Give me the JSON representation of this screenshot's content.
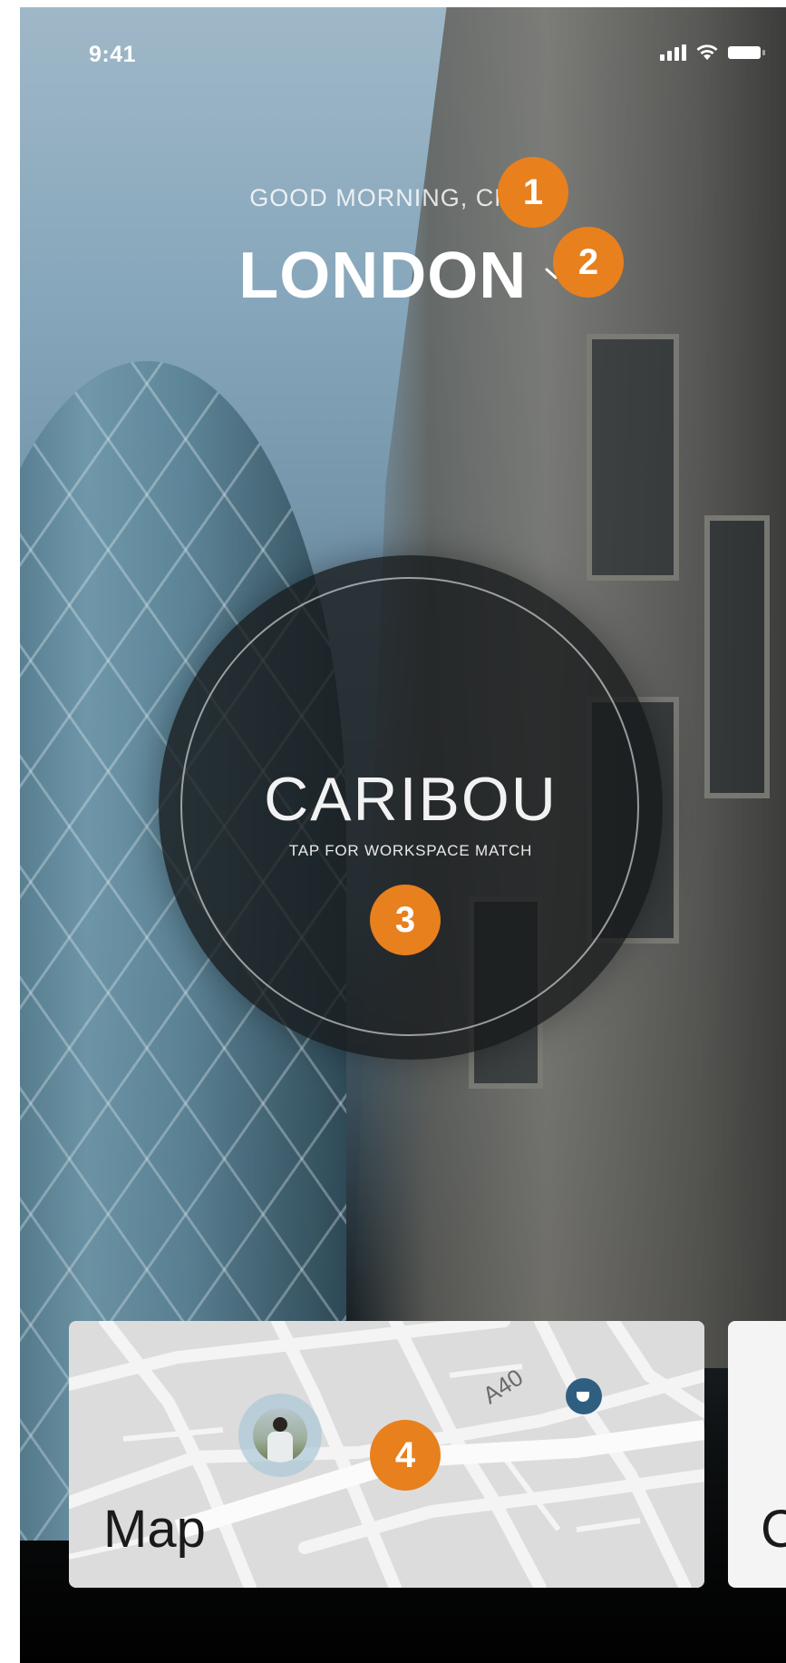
{
  "status_bar": {
    "time": "9:41"
  },
  "header": {
    "greeting": "GOOD MORNING, CHRIS",
    "city": "LONDON"
  },
  "match": {
    "brand": "CARIBOU",
    "tagline": "TAP FOR WORKSPACE MATCH"
  },
  "cards": {
    "map": {
      "title": "Map",
      "road_label": "A40"
    },
    "next": {
      "title": "C"
    }
  },
  "annotations": [
    "1",
    "2",
    "3",
    "4"
  ],
  "colors": {
    "badge": "#e8801e",
    "pin": "#2f5f80",
    "overlay": "#16181a"
  }
}
